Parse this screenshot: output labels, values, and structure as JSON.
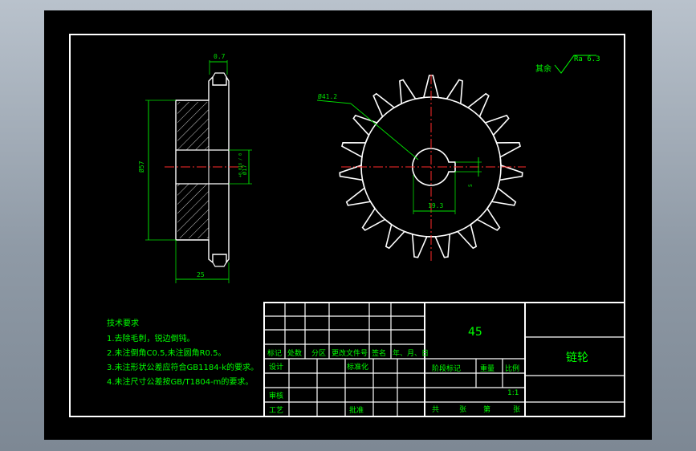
{
  "surface_finish": {
    "prefix": "其余",
    "value": "Ra 6.3"
  },
  "dims": {
    "hub_step": "0.7",
    "hub_dia": "Ø57",
    "bore_dia": "Ø17",
    "bore_tol": "+0.018 / 0",
    "width": "25",
    "pcd": "Ø41.2",
    "keyway_depth": "19.3",
    "key_width": "5"
  },
  "tech_requirements": {
    "title": "技术要求",
    "items": [
      "1.去除毛刺，锐边倒钝。",
      "2.未注倒角C0.5,未注圆角R0.5。",
      "3.未注形状公差应符合GB1184-k的要求。",
      "4.未注尺寸公差按GB/T1804-m的要求。"
    ]
  },
  "title_block": {
    "material": "45",
    "part_name": "链轮",
    "scale": "1:1",
    "rev_headers": [
      "标记",
      "处数",
      "分区",
      "更改文件号",
      "签名",
      "年、月、日"
    ],
    "design": "设计",
    "standardize": "标准化",
    "review": "审核",
    "process": "工艺",
    "approve": "批准",
    "stage_mark": "阶段标记",
    "weight": "重量",
    "ratio": "比例",
    "total": "共",
    "sheets": "张",
    "page_no": "第",
    "sheet2": "张"
  },
  "colors": {
    "line": "#ffffff",
    "text": "#00ff00",
    "center": "#ff2a2a",
    "dim_text": "#00e000"
  }
}
